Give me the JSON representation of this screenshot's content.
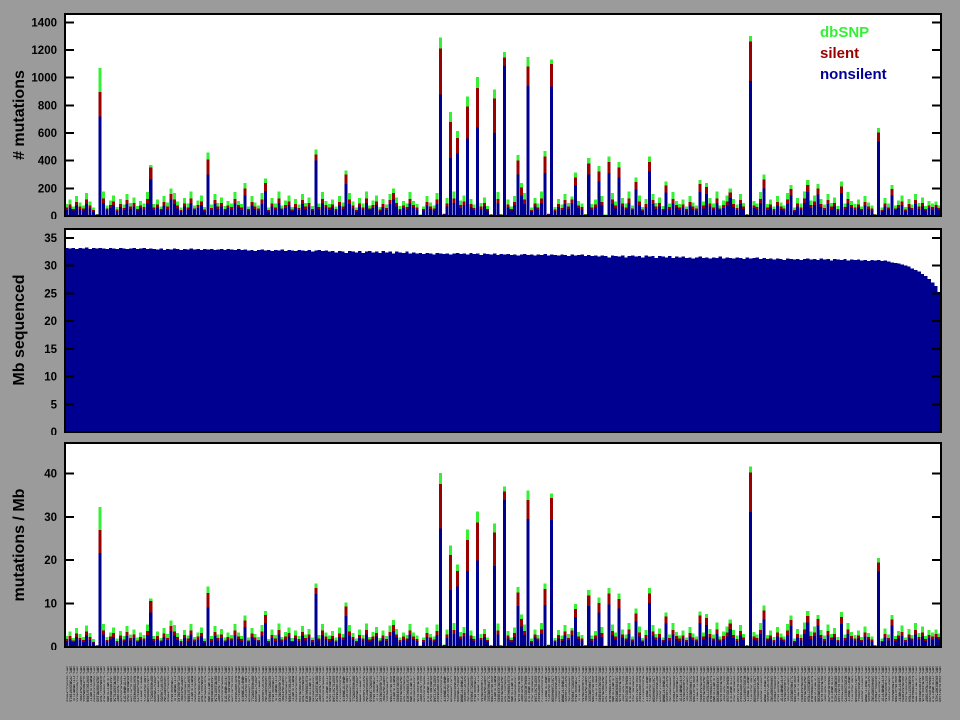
{
  "figure": {
    "background_color": "#9b9b9b",
    "description": "Three stacked MATLAB-style bar panels: mutation counts, Mb sequenced, and mutation rate per sample"
  },
  "chart_data": {
    "type": "bar",
    "n_samples": 260,
    "grid": false,
    "legend_position": "top-right inside first panel",
    "panels": [
      {
        "ylabel": "# mutations",
        "yticks": [
          0,
          200,
          400,
          600,
          800,
          1000,
          1200,
          1400
        ],
        "ylim": [
          0,
          1460
        ],
        "kind": "stacked"
      },
      {
        "ylabel": "Mb sequenced",
        "yticks": [
          0,
          5,
          10,
          15,
          20,
          25,
          30,
          35
        ],
        "ylim": [
          0,
          36.6
        ],
        "kind": "mb"
      },
      {
        "ylabel": "mutations / Mb",
        "yticks": [
          0,
          10,
          20,
          30,
          40
        ],
        "ylim": [
          0,
          47
        ],
        "kind": "ratio",
        "note": "stacked mutation counts divided by Mb sequenced per sample"
      }
    ],
    "legend": [
      {
        "label": "dbSNP",
        "color": "#35f035"
      },
      {
        "label": "silent",
        "color": "#990000"
      },
      {
        "label": "nonsilent",
        "color": "#000099"
      }
    ],
    "colors": {
      "nonsilent": "#000090",
      "silent": "#990000",
      "dbsnp": "#35f035",
      "axis": "#000000",
      "plot_bg": "#ffffff"
    },
    "stack_order_bottom_to_top": [
      "nonsilent",
      "silent",
      "dbsnp"
    ],
    "series": {
      "nonsilent": [
        45,
        62,
        38,
        75,
        52,
        40,
        88,
        55,
        34,
        8,
        720,
        95,
        42,
        58,
        78,
        36,
        64,
        44,
        85,
        50,
        70,
        39,
        57,
        48,
        92,
        265,
        45,
        62,
        38,
        75,
        52,
        120,
        88,
        55,
        34,
        68,
        47,
        95,
        42,
        58,
        78,
        36,
        300,
        44,
        85,
        50,
        70,
        39,
        57,
        48,
        92,
        60,
        45,
        150,
        38,
        75,
        52,
        40,
        88,
        180,
        34,
        68,
        47,
        95,
        42,
        58,
        78,
        36,
        64,
        44,
        85,
        50,
        70,
        39,
        400,
        48,
        92,
        60,
        45,
        62,
        38,
        75,
        52,
        230,
        88,
        55,
        34,
        68,
        47,
        95,
        42,
        58,
        78,
        36,
        64,
        44,
        85,
        120,
        70,
        39,
        57,
        48,
        92,
        60,
        45,
        6,
        38,
        75,
        52,
        40,
        88,
        880,
        10,
        68,
        420,
        95,
        450,
        58,
        78,
        560,
        64,
        44,
        640,
        50,
        70,
        39,
        8,
        600,
        92,
        8,
        1085,
        62,
        38,
        75,
        300,
        150,
        88,
        940,
        34,
        68,
        47,
        95,
        310,
        10,
        935,
        36,
        64,
        44,
        85,
        50,
        90,
        220,
        57,
        48,
        8,
        300,
        45,
        62,
        250,
        75,
        6,
        310,
        88,
        55,
        280,
        68,
        47,
        95,
        42,
        190,
        78,
        36,
        64,
        320,
        85,
        50,
        70,
        39,
        170,
        48,
        92,
        60,
        45,
        62,
        38,
        75,
        52,
        40,
        175,
        55,
        160,
        68,
        47,
        95,
        42,
        58,
        78,
        130,
        64,
        44,
        85,
        50,
        8,
        975,
        57,
        48,
        92,
        200,
        45,
        62,
        38,
        75,
        52,
        40,
        88,
        150,
        34,
        68,
        47,
        95,
        175,
        58,
        78,
        155,
        64,
        44,
        85,
        50,
        70,
        39,
        165,
        48,
        92,
        60,
        45,
        62,
        38,
        75,
        52,
        40,
        8,
        540,
        34,
        68,
        47,
        150,
        42,
        58,
        78,
        36,
        64,
        44,
        85,
        50,
        70,
        39,
        57,
        48,
        60,
        45
      ],
      "silent": [
        15,
        22,
        12,
        28,
        18,
        14,
        30,
        20,
        10,
        3,
        175,
        32,
        13,
        21,
        27,
        11,
        23,
        15,
        29,
        17,
        25,
        12,
        20,
        16,
        31,
        85,
        15,
        22,
        12,
        28,
        18,
        40,
        30,
        20,
        10,
        24,
        16,
        32,
        13,
        21,
        27,
        11,
        110,
        15,
        29,
        17,
        25,
        12,
        20,
        16,
        31,
        19,
        15,
        50,
        12,
        28,
        18,
        14,
        30,
        60,
        10,
        24,
        16,
        32,
        13,
        21,
        27,
        11,
        23,
        15,
        29,
        17,
        25,
        12,
        45,
        16,
        31,
        19,
        15,
        22,
        12,
        28,
        18,
        70,
        30,
        20,
        10,
        24,
        16,
        32,
        13,
        21,
        27,
        11,
        23,
        15,
        29,
        45,
        25,
        12,
        20,
        16,
        31,
        19,
        15,
        2,
        12,
        28,
        18,
        14,
        30,
        330,
        4,
        24,
        260,
        32,
        115,
        21,
        27,
        230,
        23,
        15,
        285,
        17,
        25,
        12,
        3,
        250,
        31,
        3,
        60,
        22,
        12,
        28,
        100,
        55,
        30,
        140,
        10,
        24,
        16,
        32,
        120,
        3,
        165,
        11,
        23,
        15,
        29,
        17,
        30,
        60,
        20,
        16,
        3,
        80,
        15,
        22,
        70,
        28,
        2,
        80,
        30,
        20,
        70,
        24,
        16,
        32,
        13,
        55,
        27,
        11,
        23,
        70,
        29,
        17,
        25,
        12,
        50,
        16,
        31,
        19,
        15,
        22,
        12,
        28,
        18,
        14,
        55,
        20,
        50,
        24,
        16,
        32,
        13,
        21,
        27,
        40,
        23,
        15,
        29,
        17,
        3,
        285,
        20,
        16,
        31,
        65,
        15,
        22,
        12,
        28,
        18,
        14,
        30,
        45,
        10,
        24,
        16,
        32,
        50,
        21,
        27,
        45,
        23,
        15,
        29,
        17,
        25,
        12,
        50,
        16,
        31,
        19,
        15,
        22,
        12,
        28,
        18,
        14,
        3,
        65,
        10,
        24,
        16,
        45,
        13,
        21,
        27,
        11,
        23,
        15,
        29,
        17,
        25,
        12,
        20,
        16,
        18,
        12
      ],
      "dbsnp": [
        25,
        35,
        20,
        42,
        28,
        22,
        48,
        30,
        18,
        4,
        175,
        50,
        21,
        33,
        44,
        19,
        36,
        24,
        46,
        27,
        40,
        20,
        32,
        26,
        49,
        20,
        25,
        35,
        20,
        42,
        28,
        40,
        48,
        30,
        18,
        38,
        26,
        50,
        21,
        33,
        44,
        19,
        50,
        24,
        46,
        27,
        40,
        20,
        32,
        26,
        49,
        30,
        25,
        40,
        20,
        42,
        28,
        22,
        48,
        30,
        18,
        38,
        26,
        50,
        21,
        33,
        44,
        19,
        36,
        24,
        46,
        27,
        40,
        20,
        35,
        26,
        49,
        30,
        25,
        35,
        20,
        42,
        28,
        30,
        48,
        30,
        18,
        38,
        26,
        50,
        21,
        33,
        44,
        19,
        36,
        24,
        46,
        35,
        40,
        20,
        32,
        26,
        49,
        30,
        25,
        3,
        20,
        42,
        28,
        22,
        48,
        80,
        5,
        38,
        70,
        50,
        50,
        33,
        44,
        75,
        36,
        24,
        80,
        27,
        40,
        20,
        4,
        65,
        49,
        4,
        40,
        35,
        20,
        42,
        40,
        35,
        48,
        70,
        18,
        38,
        26,
        50,
        40,
        4,
        30,
        19,
        36,
        24,
        46,
        27,
        20,
        35,
        32,
        26,
        4,
        40,
        25,
        35,
        40,
        42,
        3,
        40,
        48,
        30,
        40,
        38,
        26,
        50,
        21,
        35,
        44,
        19,
        36,
        40,
        46,
        27,
        40,
        20,
        30,
        26,
        49,
        30,
        25,
        35,
        20,
        42,
        28,
        22,
        30,
        30,
        30,
        38,
        26,
        50,
        21,
        33,
        44,
        30,
        36,
        24,
        46,
        27,
        4,
        40,
        32,
        26,
        49,
        35,
        25,
        35,
        20,
        42,
        28,
        22,
        48,
        30,
        18,
        38,
        26,
        50,
        35,
        33,
        44,
        30,
        36,
        24,
        46,
        27,
        40,
        20,
        35,
        26,
        49,
        30,
        25,
        35,
        20,
        42,
        28,
        22,
        4,
        30,
        18,
        38,
        26,
        30,
        21,
        33,
        44,
        19,
        36,
        24,
        46,
        27,
        40,
        20,
        32,
        26,
        28,
        20
      ]
    },
    "mb": [
      33.2,
      33.1,
      33.2,
      33.0,
      33.2,
      33.1,
      33.3,
      33.0,
      33.2,
      33.1,
      33.2,
      33.1,
      33.0,
      33.2,
      33.1,
      33.0,
      33.2,
      33.1,
      33.0,
      33.1,
      33.2,
      33.0,
      33.1,
      33.2,
      33.0,
      33.1,
      33.0,
      32.9,
      33.1,
      32.8,
      33.0,
      32.9,
      33.1,
      33.0,
      32.8,
      33.0,
      32.9,
      33.1,
      32.9,
      33.0,
      32.8,
      33.0,
      32.9,
      33.0,
      32.8,
      32.9,
      33.0,
      32.8,
      33.0,
      32.9,
      32.8,
      33.0,
      32.8,
      32.9,
      32.7,
      32.8,
      32.6,
      32.8,
      32.9,
      32.7,
      32.8,
      32.6,
      32.8,
      32.7,
      32.9,
      32.6,
      32.8,
      32.7,
      32.6,
      32.8,
      32.7,
      32.6,
      32.8,
      32.5,
      32.7,
      32.8,
      32.6,
      32.7,
      32.5,
      32.6,
      32.4,
      32.6,
      32.5,
      32.3,
      32.6,
      32.5,
      32.4,
      32.6,
      32.3,
      32.5,
      32.6,
      32.4,
      32.5,
      32.3,
      32.6,
      32.4,
      32.5,
      32.2,
      32.5,
      32.4,
      32.3,
      32.5,
      32.2,
      32.4,
      32.2,
      32.3,
      32.1,
      32.3,
      32.2,
      32.0,
      32.3,
      32.2,
      32.1,
      32.2,
      32.0,
      32.2,
      32.3,
      32.1,
      32.2,
      32.0,
      32.3,
      32.1,
      32.2,
      31.9,
      32.2,
      32.1,
      32.0,
      32.2,
      31.9,
      32.1,
      32.0,
      32.1,
      31.9,
      32.0,
      31.8,
      32.0,
      32.1,
      31.9,
      32.0,
      31.8,
      32.0,
      31.9,
      32.1,
      31.8,
      32.0,
      31.9,
      31.8,
      32.0,
      31.9,
      31.7,
      32.0,
      31.8,
      31.9,
      32.0,
      31.7,
      31.9,
      31.7,
      31.8,
      31.6,
      31.8,
      31.7,
      31.5,
      31.8,
      31.7,
      31.6,
      31.8,
      31.5,
      31.7,
      31.8,
      31.6,
      31.7,
      31.5,
      31.8,
      31.6,
      31.7,
      31.4,
      31.7,
      31.6,
      31.5,
      31.7,
      31.4,
      31.6,
      31.5,
      31.6,
      31.4,
      31.5,
      31.3,
      31.5,
      31.6,
      31.4,
      31.5,
      31.3,
      31.5,
      31.4,
      31.6,
      31.3,
      31.5,
      31.4,
      31.3,
      31.5,
      31.4,
      31.2,
      31.5,
      31.3,
      31.4,
      31.5,
      31.2,
      31.4,
      31.2,
      31.3,
      31.1,
      31.3,
      31.2,
      31.0,
      31.3,
      31.2,
      31.1,
      31.2,
      31.0,
      31.2,
      31.3,
      31.1,
      31.2,
      31.0,
      31.3,
      31.1,
      31.2,
      30.9,
      31.2,
      31.1,
      31.0,
      31.2,
      30.9,
      31.1,
      31.0,
      31.1,
      30.9,
      31.0,
      30.8,
      31.0,
      30.9,
      31.0,
      30.8,
      30.9,
      30.7,
      30.6,
      30.5,
      30.4,
      30.2,
      30.0,
      29.8,
      29.5,
      29.2,
      28.9,
      28.5,
      28.1,
      27.6,
      27.0,
      26.3,
      25.2
    ],
    "x_tick_labels": {
      "note": "260 vertically rotated per-sample identifier labels, illegible at screenshot resolution",
      "placeholder_prefix": "SMPL"
    }
  }
}
